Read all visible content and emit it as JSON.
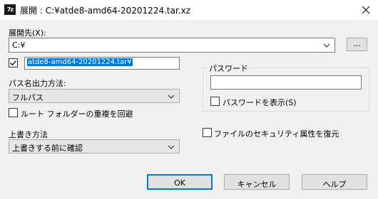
{
  "window": {
    "title": "展開 : C:¥atde8-amd64-20201224.tar.xz",
    "app_icon_text": "7z"
  },
  "extract_to": {
    "label": "展開先(X):",
    "path": "C:¥",
    "browse_label": "..."
  },
  "subfolder": {
    "checked": true,
    "value": "atde8-amd64-20201224.tar¥"
  },
  "path_mode": {
    "label": "パス名出力方法:",
    "selected": "フルパス"
  },
  "eliminate_dup": {
    "checked": false,
    "label": "ルート フォルダーの重複を回避"
  },
  "overwrite": {
    "label": "上書き方法",
    "selected": "上書きする前に確認"
  },
  "password": {
    "group_label": "パスワード",
    "value": "",
    "show_checked": false,
    "show_label": "パスワードを表示(S)"
  },
  "security": {
    "checked": false,
    "label": "ファイルのセキュリティ属性を復元"
  },
  "buttons": {
    "ok": "OK",
    "cancel": "キャンセル",
    "help": "ヘルプ"
  }
}
